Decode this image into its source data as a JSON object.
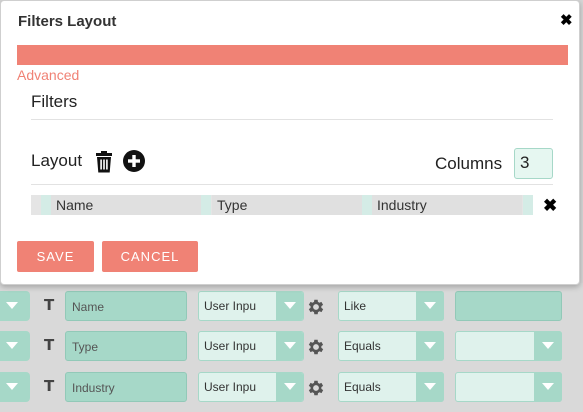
{
  "modal": {
    "title": "Filters Layout",
    "close_glyph": "✖",
    "advanced_label": "Advanced",
    "filters_heading": "Filters",
    "layout_label": "Layout",
    "columns_label": "Columns",
    "columns_value": "3",
    "layout_columns": [
      "Name",
      "Type",
      "Industry"
    ],
    "remove_glyph": "✖",
    "save_label": "SAVE",
    "cancel_label": "CANCEL",
    "accent_color": "#f08275"
  },
  "filter_rows": [
    {
      "type_glyph": "T",
      "field": "Name",
      "input_type": "User Inpu",
      "operator": "Like"
    },
    {
      "type_glyph": "T",
      "field": "Type",
      "input_type": "User Inpu",
      "operator": "Equals"
    },
    {
      "type_glyph": "T",
      "field": "Industry",
      "input_type": "User Inpu",
      "operator": "Equals"
    }
  ],
  "icons": [
    "trash-icon",
    "plus-circle-icon",
    "gear-icon",
    "chevron-down-icon",
    "text-type-icon",
    "close-icon"
  ]
}
